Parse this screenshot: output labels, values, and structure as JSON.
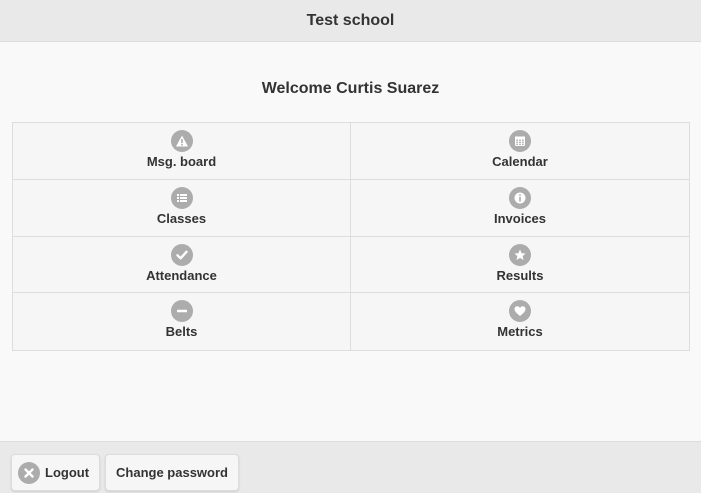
{
  "header": {
    "title": "Test school"
  },
  "welcome": "Welcome Curtis Suarez",
  "menu": [
    {
      "label": "Msg. board",
      "icon": "alert-icon"
    },
    {
      "label": "Calendar",
      "icon": "calendar-icon"
    },
    {
      "label": "Classes",
      "icon": "list-icon"
    },
    {
      "label": "Invoices",
      "icon": "info-icon"
    },
    {
      "label": "Attendance",
      "icon": "check-icon"
    },
    {
      "label": "Results",
      "icon": "star-icon"
    },
    {
      "label": "Belts",
      "icon": "minus-icon"
    },
    {
      "label": "Metrics",
      "icon": "heart-icon"
    }
  ],
  "footer": {
    "logout_label": "Logout",
    "logout_icon": "close-icon",
    "change_password_label": "Change password"
  },
  "colors": {
    "header_bg": "#e9e9e9",
    "page_bg": "#f9f9f9",
    "icon_bg": "#acacac",
    "text": "#333333"
  }
}
